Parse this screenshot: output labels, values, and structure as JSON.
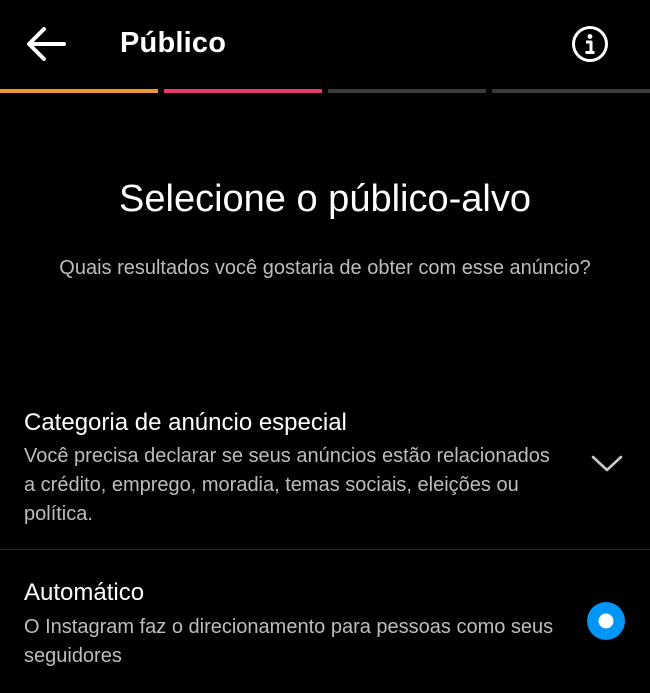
{
  "header": {
    "back_icon": "arrow-left-icon",
    "title": "Público",
    "info_icon": "info-circle-icon"
  },
  "progress": {
    "total_steps": 4,
    "completed_steps": 2,
    "segment_colors": [
      "#f09433",
      "#e6396a",
      "#3a3a3a",
      "#3a3a3a"
    ]
  },
  "main": {
    "headline": "Selecione o público-alvo",
    "subtitle": "Quais resultados você gostaria de obter com esse anúncio?"
  },
  "options": [
    {
      "title": "Categoria de anúncio especial",
      "description": "Você precisa declarar se seus anúncios estão relacionados a crédito, emprego, moradia, temas sociais, eleições ou política.",
      "control": "chevron-down-icon"
    },
    {
      "title": "Automático",
      "description": "O Instagram faz o direcionamento para pessoas como seus seguidores",
      "control": "radio-selected",
      "selected": true
    }
  ],
  "colors": {
    "background": "#000000",
    "text_primary": "#ffffff",
    "text_secondary": "#bdbdbd",
    "accent_blue": "#0095f6",
    "divider": "#262626"
  }
}
